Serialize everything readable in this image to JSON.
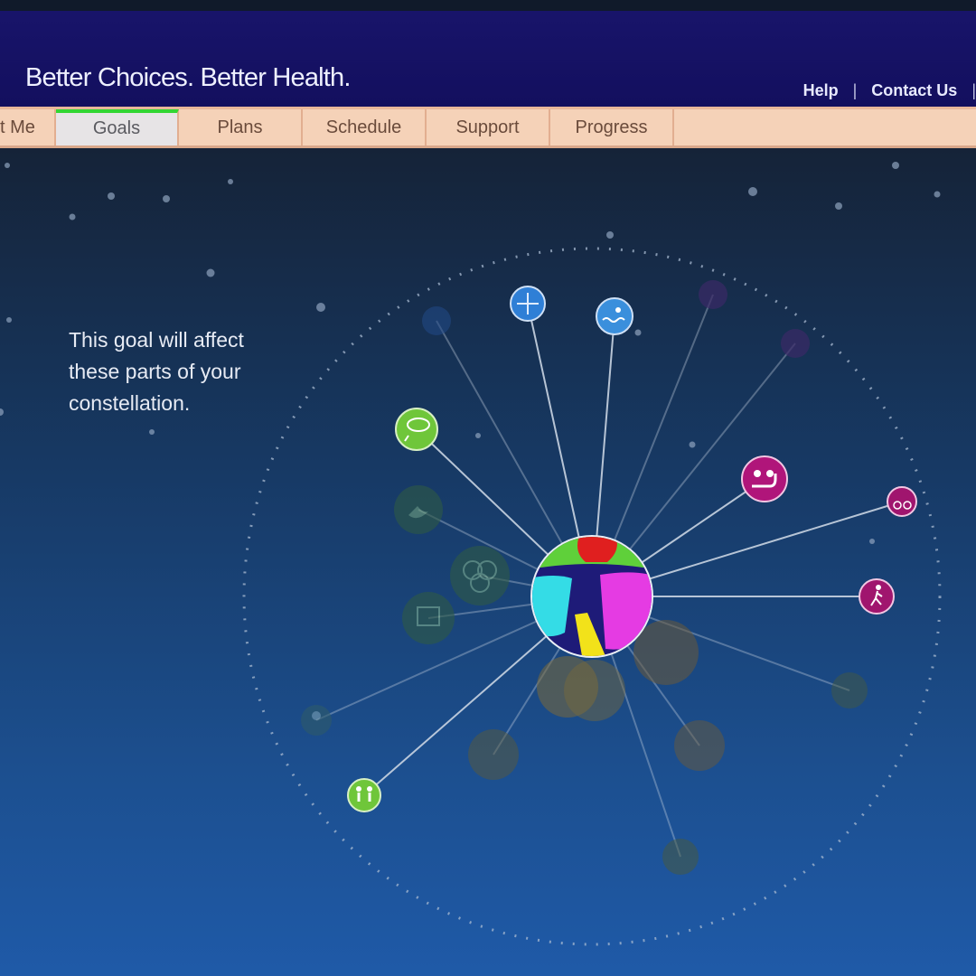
{
  "header": {
    "tagline": "Better Choices. Better Health.",
    "links": [
      "Help",
      "Contact Us"
    ]
  },
  "tabs": [
    {
      "label": "t Me",
      "active": false
    },
    {
      "label": "Goals",
      "active": true
    },
    {
      "label": "Plans",
      "active": false
    },
    {
      "label": "Schedule",
      "active": false
    },
    {
      "label": "Support",
      "active": false
    },
    {
      "label": "Progress",
      "active": false
    }
  ],
  "main": {
    "message_lines": [
      "This goal will affect",
      "these parts of your",
      "constellation."
    ]
  },
  "constellation": {
    "center": {
      "name": "center-globe-icon"
    },
    "nodes": [
      {
        "name": "globe-icon",
        "color": "#2f7fd6",
        "state": "active"
      },
      {
        "name": "swimming-icon",
        "color": "#3a8fdc",
        "state": "active"
      },
      {
        "name": "food-icon",
        "color": "#6fc63a",
        "state": "active"
      },
      {
        "name": "weightlifting-icon",
        "color": "#b0157a",
        "state": "active"
      },
      {
        "name": "cycling-icon",
        "color": "#a0156e",
        "state": "active"
      },
      {
        "name": "walking-icon",
        "color": "#a0156e",
        "state": "active"
      },
      {
        "name": "family-icon",
        "color": "#6fc63a",
        "state": "active"
      },
      {
        "name": "sleep-icon",
        "color": "#3a6a4a",
        "state": "dim"
      },
      {
        "name": "rings-icon",
        "color": "#3a6a4a",
        "state": "dim"
      },
      {
        "name": "film-icon",
        "color": "#3a6a4a",
        "state": "dim"
      },
      {
        "name": "person-icon",
        "color": "#2e5a6a",
        "state": "dim"
      },
      {
        "name": "faded-node-icon",
        "color": "#234a88",
        "state": "dim"
      },
      {
        "name": "faded-node-icon",
        "color": "#3a2a66",
        "state": "dim"
      },
      {
        "name": "faded-node-icon",
        "color": "#3a2a66",
        "state": "dim"
      },
      {
        "name": "faded-node-icon",
        "color": "#6a5a3a",
        "state": "dim"
      },
      {
        "name": "faded-node-icon",
        "color": "#6a5a3a",
        "state": "dim"
      },
      {
        "name": "faded-node-icon",
        "color": "#6a5a3a",
        "state": "dim"
      },
      {
        "name": "faded-node-icon",
        "color": "#6a5a3a",
        "state": "dim"
      },
      {
        "name": "faded-node-icon",
        "color": "#5a5a3a",
        "state": "dim"
      },
      {
        "name": "faded-node-icon",
        "color": "#4a5a3a",
        "state": "dim"
      }
    ]
  }
}
